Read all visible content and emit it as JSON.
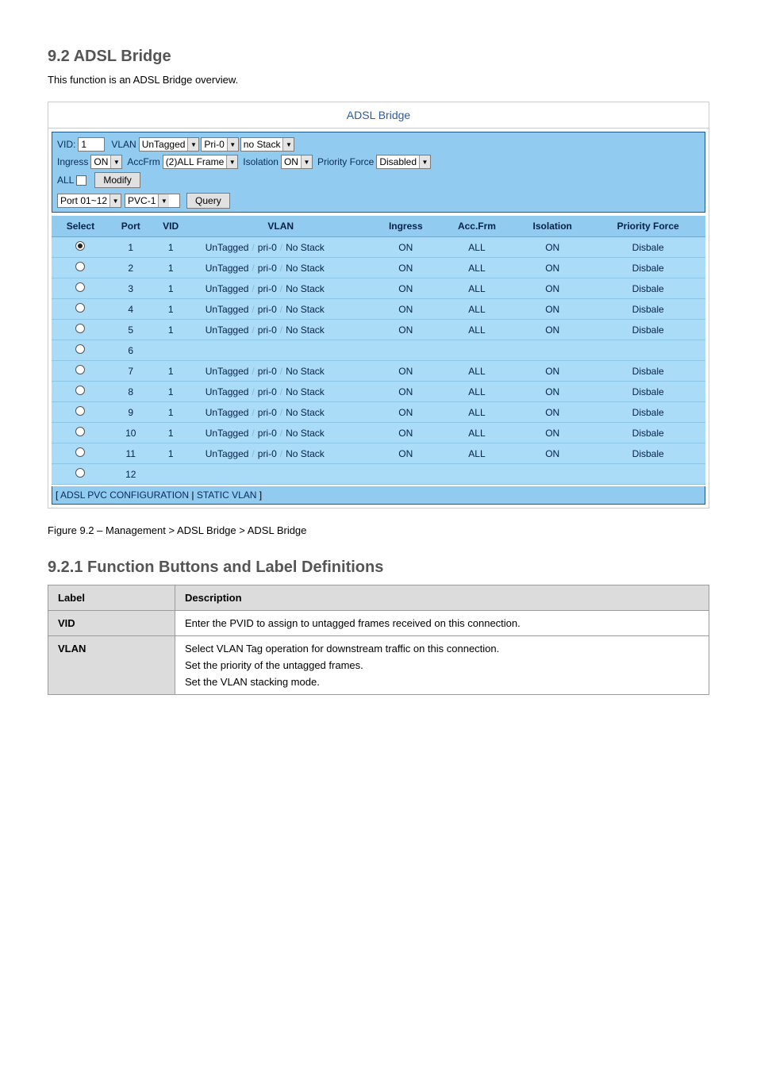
{
  "page": {
    "title": "9.2 ADSL Bridge",
    "intro": "This function is an ADSL Bridge overview."
  },
  "figure": {
    "heading": "ADSL Bridge",
    "toolbar": {
      "vid_label": "VID:",
      "vid_value": "1",
      "vlan_label": "VLAN",
      "vlan_sel": "UnTagged",
      "pri_sel": "Pri-0",
      "stack_sel": "no Stack",
      "ingress_label": "Ingress",
      "ingress_sel": "ON",
      "accfrm_label": "AccFrm",
      "accfrm_sel": "(2)ALL Frame",
      "isolation_label": "Isolation",
      "isolation_sel": "ON",
      "priority_force_label": "Priority Force",
      "priority_force_sel": "Disabled",
      "all_label": "ALL",
      "modify_btn": "Modify",
      "port_sel": "Port 01~12",
      "pvc_sel": "PVC-1",
      "query_btn": "Query"
    },
    "columns": {
      "select": "Select",
      "port": "Port",
      "vid": "VID",
      "vlan": "VLAN",
      "ingress": "Ingress",
      "accfrm": "Acc.Frm",
      "isolation": "Isolation",
      "priority_force": "Priority Force"
    },
    "rows": [
      {
        "selected": true,
        "port": "1",
        "vid": "1",
        "tag": "UnTagged",
        "pri": "pri-0",
        "stack": "No Stack",
        "ingress": "ON",
        "accfrm": "ALL",
        "isolation": "ON",
        "priority": "Disbale"
      },
      {
        "selected": false,
        "port": "2",
        "vid": "1",
        "tag": "UnTagged",
        "pri": "pri-0",
        "stack": "No Stack",
        "ingress": "ON",
        "accfrm": "ALL",
        "isolation": "ON",
        "priority": "Disbale"
      },
      {
        "selected": false,
        "port": "3",
        "vid": "1",
        "tag": "UnTagged",
        "pri": "pri-0",
        "stack": "No Stack",
        "ingress": "ON",
        "accfrm": "ALL",
        "isolation": "ON",
        "priority": "Disbale"
      },
      {
        "selected": false,
        "port": "4",
        "vid": "1",
        "tag": "UnTagged",
        "pri": "pri-0",
        "stack": "No Stack",
        "ingress": "ON",
        "accfrm": "ALL",
        "isolation": "ON",
        "priority": "Disbale"
      },
      {
        "selected": false,
        "port": "5",
        "vid": "1",
        "tag": "UnTagged",
        "pri": "pri-0",
        "stack": "No Stack",
        "ingress": "ON",
        "accfrm": "ALL",
        "isolation": "ON",
        "priority": "Disbale"
      },
      {
        "selected": false,
        "port": "6",
        "vid": "",
        "tag": "",
        "pri": "",
        "stack": "",
        "ingress": "",
        "accfrm": "",
        "isolation": "",
        "priority": ""
      },
      {
        "selected": false,
        "port": "7",
        "vid": "1",
        "tag": "UnTagged",
        "pri": "pri-0",
        "stack": "No Stack",
        "ingress": "ON",
        "accfrm": "ALL",
        "isolation": "ON",
        "priority": "Disbale"
      },
      {
        "selected": false,
        "port": "8",
        "vid": "1",
        "tag": "UnTagged",
        "pri": "pri-0",
        "stack": "No Stack",
        "ingress": "ON",
        "accfrm": "ALL",
        "isolation": "ON",
        "priority": "Disbale"
      },
      {
        "selected": false,
        "port": "9",
        "vid": "1",
        "tag": "UnTagged",
        "pri": "pri-0",
        "stack": "No Stack",
        "ingress": "ON",
        "accfrm": "ALL",
        "isolation": "ON",
        "priority": "Disbale"
      },
      {
        "selected": false,
        "port": "10",
        "vid": "1",
        "tag": "UnTagged",
        "pri": "pri-0",
        "stack": "No Stack",
        "ingress": "ON",
        "accfrm": "ALL",
        "isolation": "ON",
        "priority": "Disbale"
      },
      {
        "selected": false,
        "port": "11",
        "vid": "1",
        "tag": "UnTagged",
        "pri": "pri-0",
        "stack": "No Stack",
        "ingress": "ON",
        "accfrm": "ALL",
        "isolation": "ON",
        "priority": "Disbale"
      },
      {
        "selected": false,
        "port": "12",
        "vid": "",
        "tag": "",
        "pri": "",
        "stack": "",
        "ingress": "",
        "accfrm": "",
        "isolation": "",
        "priority": ""
      }
    ],
    "footer": {
      "open": "[ ",
      "link1": "ADSL PVC CONFIGURATION",
      "sep": " | ",
      "link2": "STATIC VLAN",
      "close": " ]"
    }
  },
  "caption": "Figure 9.2 – Management > ADSL Bridge > ADSL Bridge",
  "def_title_full": "9.2.1 Function Buttons and Label Definitions",
  "label_table": {
    "h1": "Label",
    "h2": "Description",
    "r1c1": "VID",
    "r1c2": "Enter the PVID to assign to untagged frames received on this connection.",
    "r2c1": "VLAN",
    "r2c2_p1": "Select VLAN Tag operation for downstream traffic on this connection.",
    "r2c2_p2": "Set the priority of the untagged frames.",
    "r2c2_p3": "Set the VLAN stacking mode."
  }
}
